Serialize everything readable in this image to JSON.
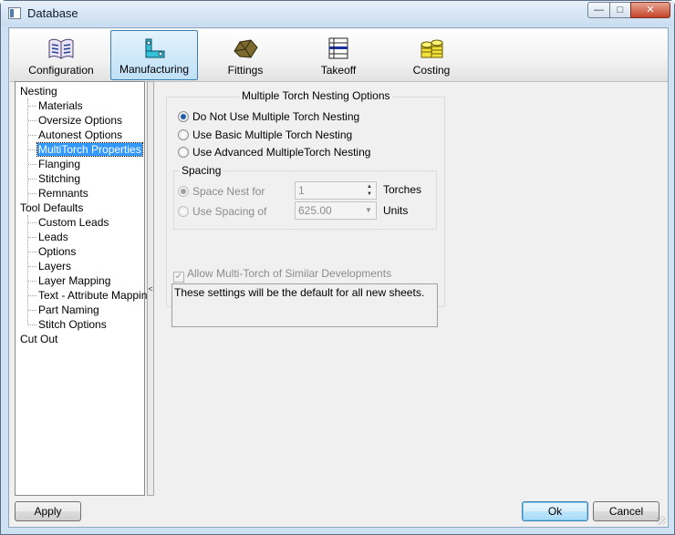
{
  "window": {
    "title": "Database"
  },
  "toolbar": {
    "tabs": [
      {
        "label": "Configuration",
        "icon": "book-icon"
      },
      {
        "label": "Manufacturing",
        "icon": "manufacturing-icon",
        "active": true
      },
      {
        "label": "Fittings",
        "icon": "fitting-icon"
      },
      {
        "label": "Takeoff",
        "icon": "takeoff-icon"
      },
      {
        "label": "Costing",
        "icon": "coins-icon"
      }
    ]
  },
  "tree": {
    "items": [
      {
        "label": "Nesting",
        "level": 0
      },
      {
        "label": "Materials",
        "level": 1
      },
      {
        "label": "Oversize Options",
        "level": 1
      },
      {
        "label": "Autonest Options",
        "level": 1
      },
      {
        "label": "MultiTorch Properties",
        "level": 1,
        "selected": true
      },
      {
        "label": "Flanging",
        "level": 1
      },
      {
        "label": "Stitching",
        "level": 1
      },
      {
        "label": "Remnants",
        "level": 1
      },
      {
        "label": "Tool Defaults",
        "level": 0
      },
      {
        "label": "Custom Leads",
        "level": 1
      },
      {
        "label": "Leads",
        "level": 1
      },
      {
        "label": "Options",
        "level": 1
      },
      {
        "label": "Layers",
        "level": 1
      },
      {
        "label": "Layer Mapping",
        "level": 1
      },
      {
        "label": "Text - Attribute Mapping",
        "level": 1
      },
      {
        "label": "Part Naming",
        "level": 1
      },
      {
        "label": "Stitch Options",
        "level": 1
      },
      {
        "label": "Cut Out",
        "level": 0
      }
    ]
  },
  "splitter": {
    "glyph": "<"
  },
  "panel": {
    "title": "Multiple Torch Nesting Options",
    "radios": [
      {
        "label": "Do Not Use Multiple Torch Nesting",
        "checked": true
      },
      {
        "label": "Use Basic Multiple Torch Nesting",
        "checked": false
      },
      {
        "label": "Use Advanced MultipleTorch Nesting",
        "checked": false
      }
    ],
    "spacing": {
      "title": "Spacing",
      "space_nest_label": "Space Nest for",
      "space_nest_value": "1",
      "torches_label": "Torches",
      "use_spacing_label": "Use Spacing of",
      "use_spacing_value": "625.00",
      "units_label": "Units"
    },
    "checkbox_label": "Allow Multi-Torch of Similar Developments",
    "checkbox_checked": true,
    "info_text": "These settings will be the default for all new sheets."
  },
  "buttons": {
    "apply": "Apply",
    "ok": "Ok",
    "cancel": "Cancel"
  },
  "caption_buttons": {
    "minimize": "—",
    "maximize": "□",
    "close": "✕"
  },
  "colors": {
    "selection": "#3399ff",
    "active_tab_border": "#3c7fb1",
    "close_button": "#c4442a"
  }
}
